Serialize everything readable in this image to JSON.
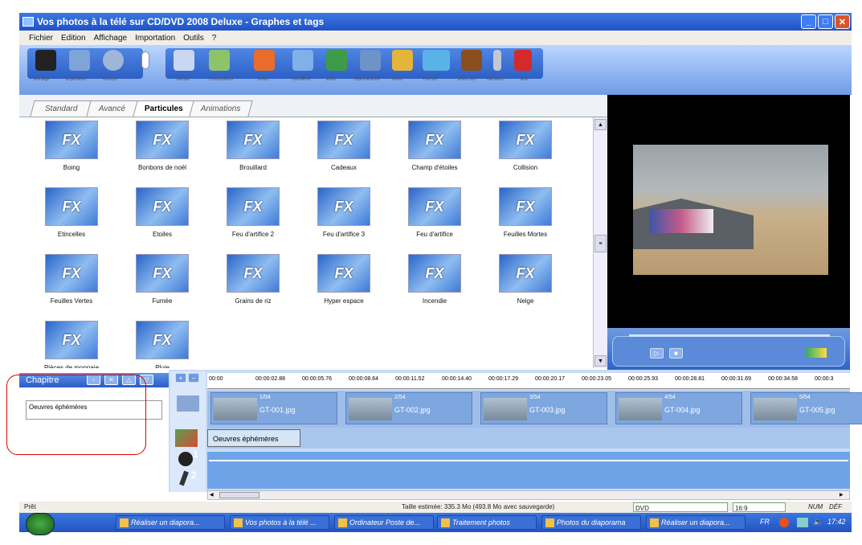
{
  "window": {
    "title": "Vos photos à la télé sur CD/DVD 2008 Deluxe - Graphes et tags"
  },
  "menu": [
    "Fichier",
    "Edition",
    "Affichage",
    "Importation",
    "Outils",
    "?"
  ],
  "toolbar": {
    "labels": [
      "Montage",
      "Exportation",
      "Gravure",
      "Médias",
      "Compositions",
      "Textes",
      "Transitions",
      "Effets",
      "Objets Animés",
      "Filtres",
      "Thèmes",
      "Effets son",
      "Narration",
      "Aide"
    ]
  },
  "tabs": [
    "Standard",
    "Avancé",
    "Particules",
    "Animations"
  ],
  "active_tab": "Particules",
  "effects_icon_text": "FX",
  "effects": [
    "Boing",
    "Bonbons de noël",
    "Brouillard",
    "Cadeaux",
    "Champ d'étoiles",
    "Collision",
    "Etincelles",
    "Etoiles",
    "Feu d'artifice 2",
    "Feu d'artifice 3",
    "Feu d'artifice",
    "Feuilles Mortes",
    "Feuilles Vertes",
    "Fumée",
    "Grains de riz",
    "Hyper espace",
    "Incendie",
    "Neige",
    "Pièces de monnaie",
    "Pluie"
  ],
  "chapter": {
    "title": "Chapitre",
    "value": "Oeuvres éphémères"
  },
  "ruler": [
    "00:00",
    "00:00:02.88",
    "00:00:05.76",
    "00:00:08.64",
    "00:00:11.52",
    "00:00:14.40",
    "00:00:17.29",
    "00:00:20.17",
    "00:00:23.05",
    "00:00:25.93",
    "00:00:28.81",
    "00:00:31.69",
    "00:00:34.58",
    "00:00:3"
  ],
  "clips": [
    {
      "count": "1/54",
      "name": "GT-001.jpg"
    },
    {
      "count": "2/54",
      "name": "GT-002.jpg"
    },
    {
      "count": "3/54",
      "name": "GT-003.jpg"
    },
    {
      "count": "4/54",
      "name": "GT-004.jpg"
    },
    {
      "count": "5/54",
      "name": "GT-005.jpg"
    }
  ],
  "text_clip": "Oeuvres éphémères",
  "track_numbers": [
    "1",
    "2"
  ],
  "status": {
    "left": "Prêt",
    "size": "Taille estimée: 335.3 Mo (493.8 Mo avec sauvegarde)",
    "format": "DVD",
    "ratio": "16:9",
    "num": "NUM",
    "def": "DÉF"
  },
  "taskbar": [
    {
      "label": "Réaliser un diapora..."
    },
    {
      "label": "Vos photos à la télé ..."
    },
    {
      "label": "Ordinateur Poste de..."
    },
    {
      "label": "Traitement photos"
    },
    {
      "label": "Photos du diaporama"
    },
    {
      "label": "Réaliser un diapora..."
    }
  ],
  "tray": {
    "lang": "FR",
    "time": "17:42"
  },
  "colors": {
    "accent": "#2a5dc7",
    "highlight": "#dd0000"
  }
}
